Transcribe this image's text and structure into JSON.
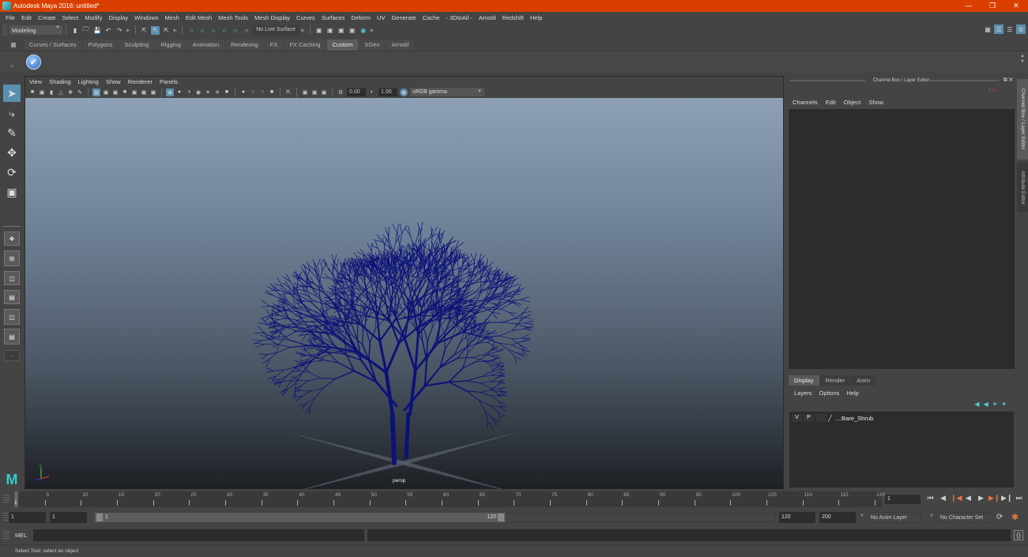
{
  "window": {
    "title": "Autodesk Maya 2016: untitled*",
    "controls": [
      "minimize",
      "restore",
      "close"
    ]
  },
  "menubar": [
    "File",
    "Edit",
    "Create",
    "Select",
    "Modify",
    "Display",
    "Windows",
    "Mesh",
    "Edit Mesh",
    "Mesh Tools",
    "Mesh Display",
    "Curves",
    "Surfaces",
    "Deform",
    "UV",
    "Generate",
    "Cache",
    "- 3DtoAll -",
    "Arnold",
    "Redshift",
    "Help"
  ],
  "status_line": {
    "menu_set": "Modeling",
    "live_surface": "No Live Surface"
  },
  "shelf": {
    "tabs": [
      "Curves / Surfaces",
      "Polygons",
      "Sculpting",
      "Rigging",
      "Animation",
      "Rendering",
      "FX",
      "FX Caching",
      "Custom",
      "XGen",
      "Arnold"
    ],
    "active_tab": "Custom",
    "items": [
      {
        "icon": "check-circle-icon"
      }
    ]
  },
  "viewport": {
    "menu": [
      "View",
      "Shading",
      "Lighting",
      "Show",
      "Renderer",
      "Panels"
    ],
    "exposure": "0.00",
    "gamma": "1.00",
    "color_space": "sRGB gamma",
    "camera_label": "persp",
    "object_color": "#0d1278",
    "axis_labels": {
      "y": "y",
      "x": "x",
      "z": "z"
    }
  },
  "channel_box": {
    "title": "Channel Box / Layer Editor",
    "menu": [
      "Channels",
      "Edit",
      "Object",
      "Show"
    ]
  },
  "side_tabs": [
    "Channel Box / Layer Editor",
    "Attribute Editor"
  ],
  "layer_editor": {
    "tabs": [
      "Display",
      "Render",
      "Anim"
    ],
    "active_tab": "Display",
    "menu": [
      "Layers",
      "Options",
      "Help"
    ],
    "layers": [
      {
        "visible": "V",
        "playback": "P",
        "name": "...:Bare_Shrub"
      }
    ]
  },
  "time_slider": {
    "ticks": [
      5,
      10,
      15,
      20,
      25,
      30,
      35,
      40,
      45,
      50,
      55,
      60,
      65,
      70,
      75,
      80,
      85,
      90,
      95,
      100,
      105,
      110,
      115,
      120
    ],
    "min": 1,
    "max": 120,
    "current_frame": "1",
    "current_field": "1"
  },
  "range_slider": {
    "start_field": "1",
    "playback_start": "1",
    "range_start_label": "1",
    "range_end_label": "120",
    "playback_end": "120",
    "end_field": "200",
    "anim_layer": "No Anim Layer",
    "character_set": "No Character Set"
  },
  "command_line": {
    "label": "MEL",
    "value": ""
  },
  "help_line": "Select Tool: select an object",
  "colors": {
    "titlebar": "#d94000",
    "accent": "#5b8fb0",
    "keyframe_marker": "#e8743b"
  }
}
